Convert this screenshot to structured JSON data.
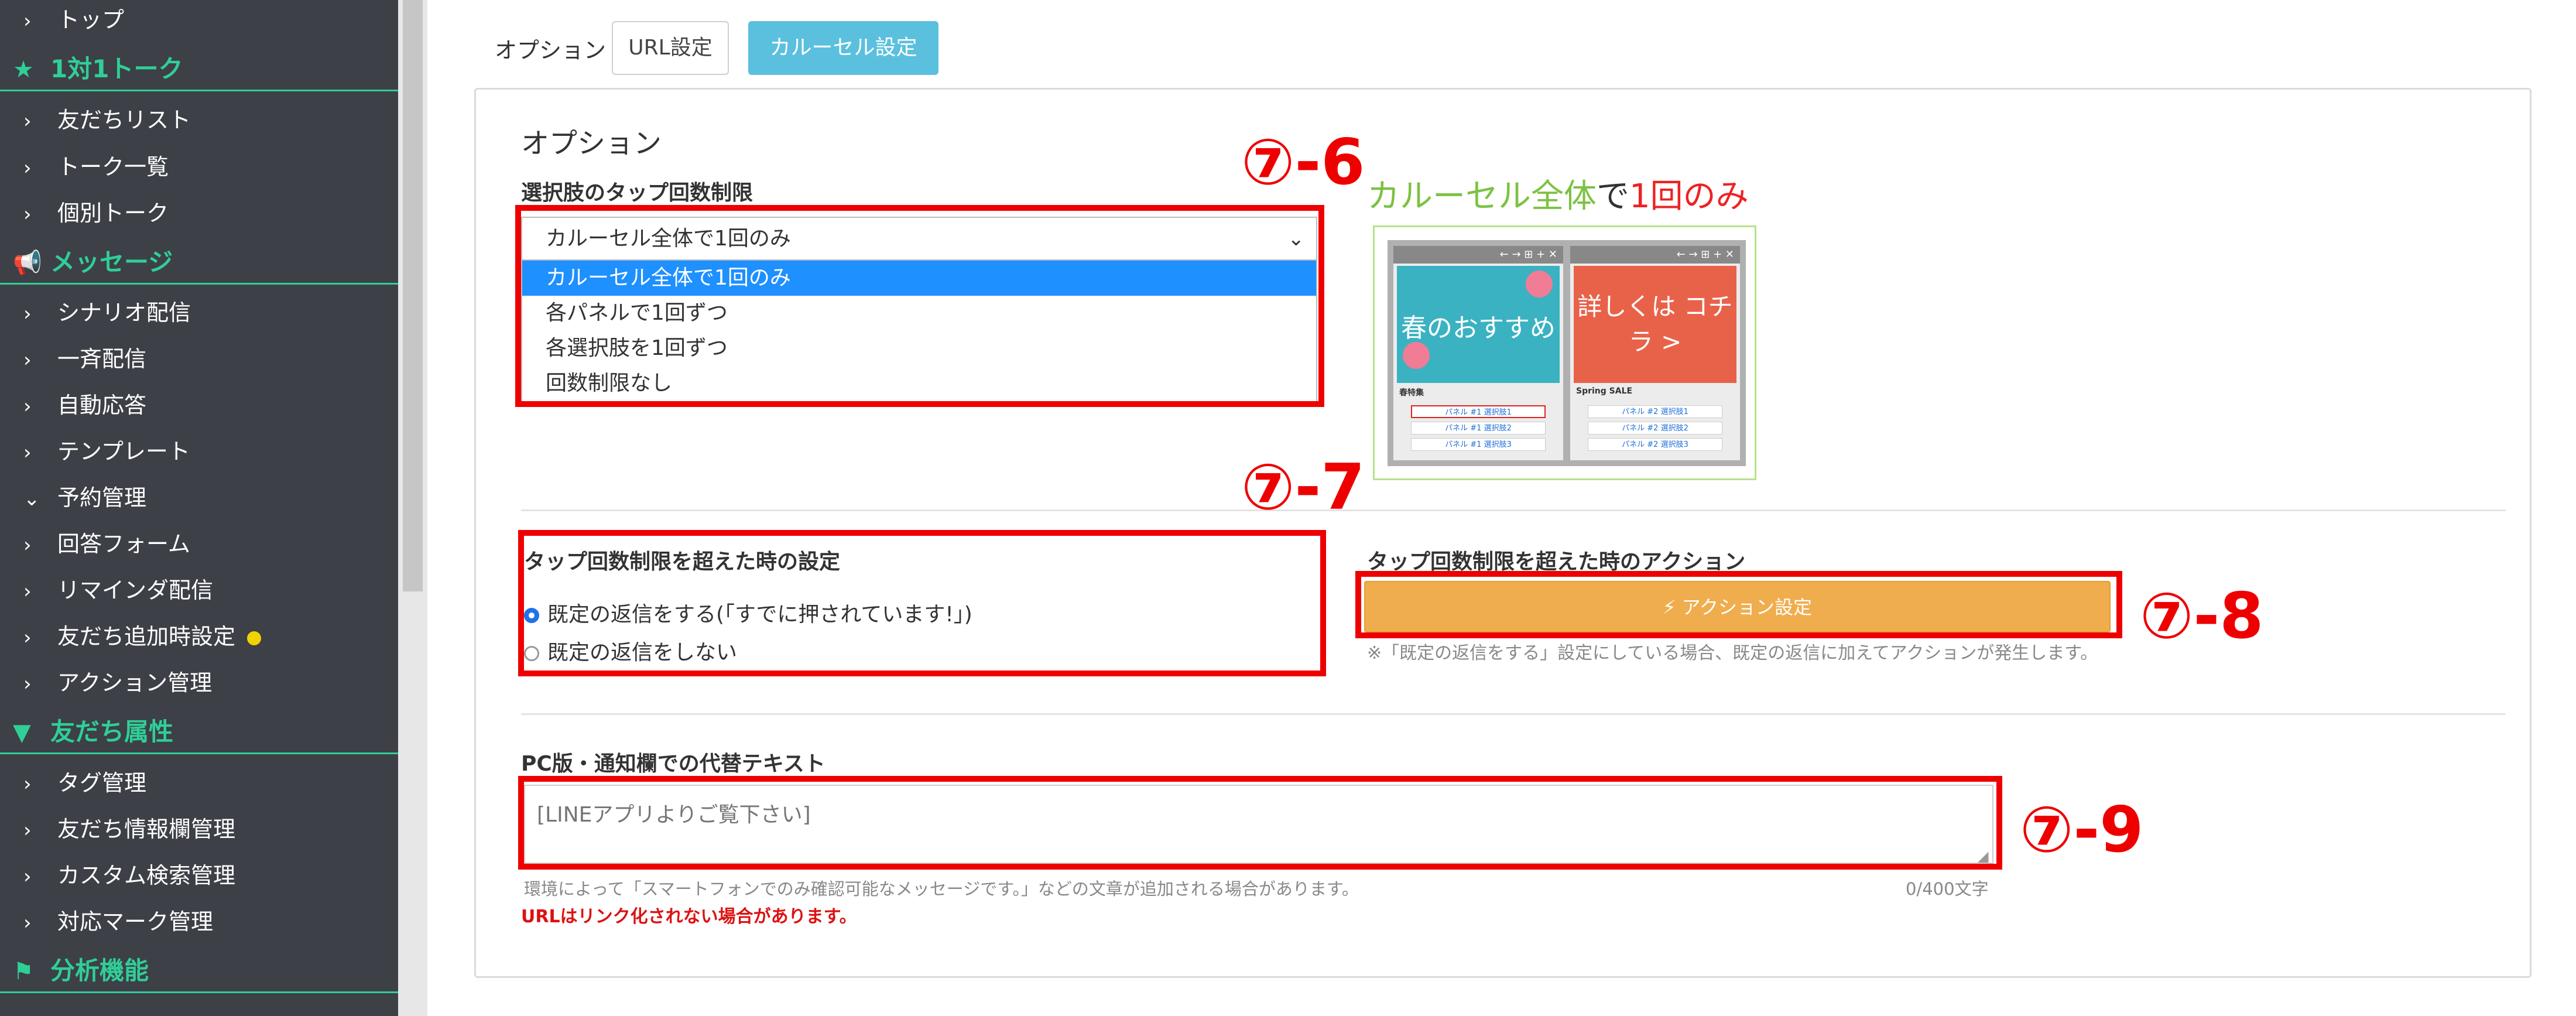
{
  "sidebar": {
    "items": [
      {
        "kind": "item",
        "label": "トップ"
      },
      {
        "kind": "section",
        "icon": "★",
        "label": "1対1トーク"
      },
      {
        "kind": "item",
        "label": "友だちリスト"
      },
      {
        "kind": "item",
        "label": "トーク一覧"
      },
      {
        "kind": "item",
        "label": "個別トーク"
      },
      {
        "kind": "section",
        "icon": "📢",
        "label": "メッセージ"
      },
      {
        "kind": "item",
        "label": "シナリオ配信"
      },
      {
        "kind": "item",
        "label": "一斉配信"
      },
      {
        "kind": "item",
        "label": "自動応答"
      },
      {
        "kind": "item",
        "label": "テンプレート"
      },
      {
        "kind": "item",
        "label": "予約管理",
        "expanded": true
      },
      {
        "kind": "item",
        "label": "回答フォーム"
      },
      {
        "kind": "item",
        "label": "リマインダ配信"
      },
      {
        "kind": "item",
        "label": "友だち追加時設定",
        "dot": true
      },
      {
        "kind": "item",
        "label": "アクション管理"
      },
      {
        "kind": "section",
        "icon": "▼",
        "label": "友だち属性"
      },
      {
        "kind": "item",
        "label": "タグ管理"
      },
      {
        "kind": "item",
        "label": "友だち情報欄管理"
      },
      {
        "kind": "item",
        "label": "カスタム検索管理"
      },
      {
        "kind": "item",
        "label": "対応マーク管理"
      },
      {
        "kind": "section",
        "icon": "⚑",
        "label": "分析機能"
      }
    ]
  },
  "options_bar": {
    "label": "オプション",
    "tabs": [
      "URL設定",
      "カルーセル設定"
    ],
    "active_tab": "カルーセル設定"
  },
  "panel": {
    "heading": "オプション",
    "tap_limit": {
      "label": "選択肢のタップ回数制限",
      "selected": "カルーセル全体で1回のみ",
      "options": [
        "カルーセル全体で1回のみ",
        "各パネルで1回ずつ",
        "各選択肢を1回ずつ",
        "回数制限なし"
      ]
    },
    "preview": {
      "caption_green": "カルーセル全体",
      "caption_dark": "で",
      "caption_red": "1回のみ",
      "panel1_bar": "← → ⊞ + ✕",
      "panel1_image_text": "春のおすすめ",
      "panel1_title": "春特集",
      "panel1_buttons": [
        "パネル #1 選択肢1",
        "パネル #1 選択肢2",
        "パネル #1 選択肢3"
      ],
      "panel2_bar": "← → ⊞ + ✕",
      "panel2_image_text": "詳しくは コチラ >",
      "panel2_title": "Spring SALE",
      "panel2_buttons": [
        "パネル #2 選択肢1",
        "パネル #2 選択肢2",
        "パネル #2 選択肢3"
      ]
    },
    "exceed_setting": {
      "label": "タップ回数制限を超えた時の設定",
      "radio1": "既定の返信をする(「すでに押されています!」)",
      "radio2": "既定の返信をしない",
      "selected": 1
    },
    "exceed_action": {
      "label": "タップ回数制限を超えた時のアクション",
      "button": "⚡ アクション設定",
      "note": "※「既定の返信をする」設定にしている場合、既定の返信に加えてアクションが発生します。"
    },
    "alt_text": {
      "label": "PC版・通知欄での代替テキスト",
      "placeholder": "[LINEアプリよりご覧下さい]",
      "hint": "環境によって「スマートフォンでのみ確認可能なメッセージです。」などの文章が追加される場合があります。",
      "counter": "0/400文字",
      "warning": "URLはリンク化されない場合があります。"
    }
  },
  "annotations": [
    "⑦-6",
    "⑦-7",
    "⑦-8",
    "⑦-9"
  ],
  "colors": {
    "sidebar_bg": "#3d4047",
    "sidebar_accent": "#2fcf97",
    "active_tab": "#5bc0de",
    "action_button": "#f0ad4e",
    "annotation_red": "#ee0000",
    "select_highlight": "#1e90ff"
  }
}
